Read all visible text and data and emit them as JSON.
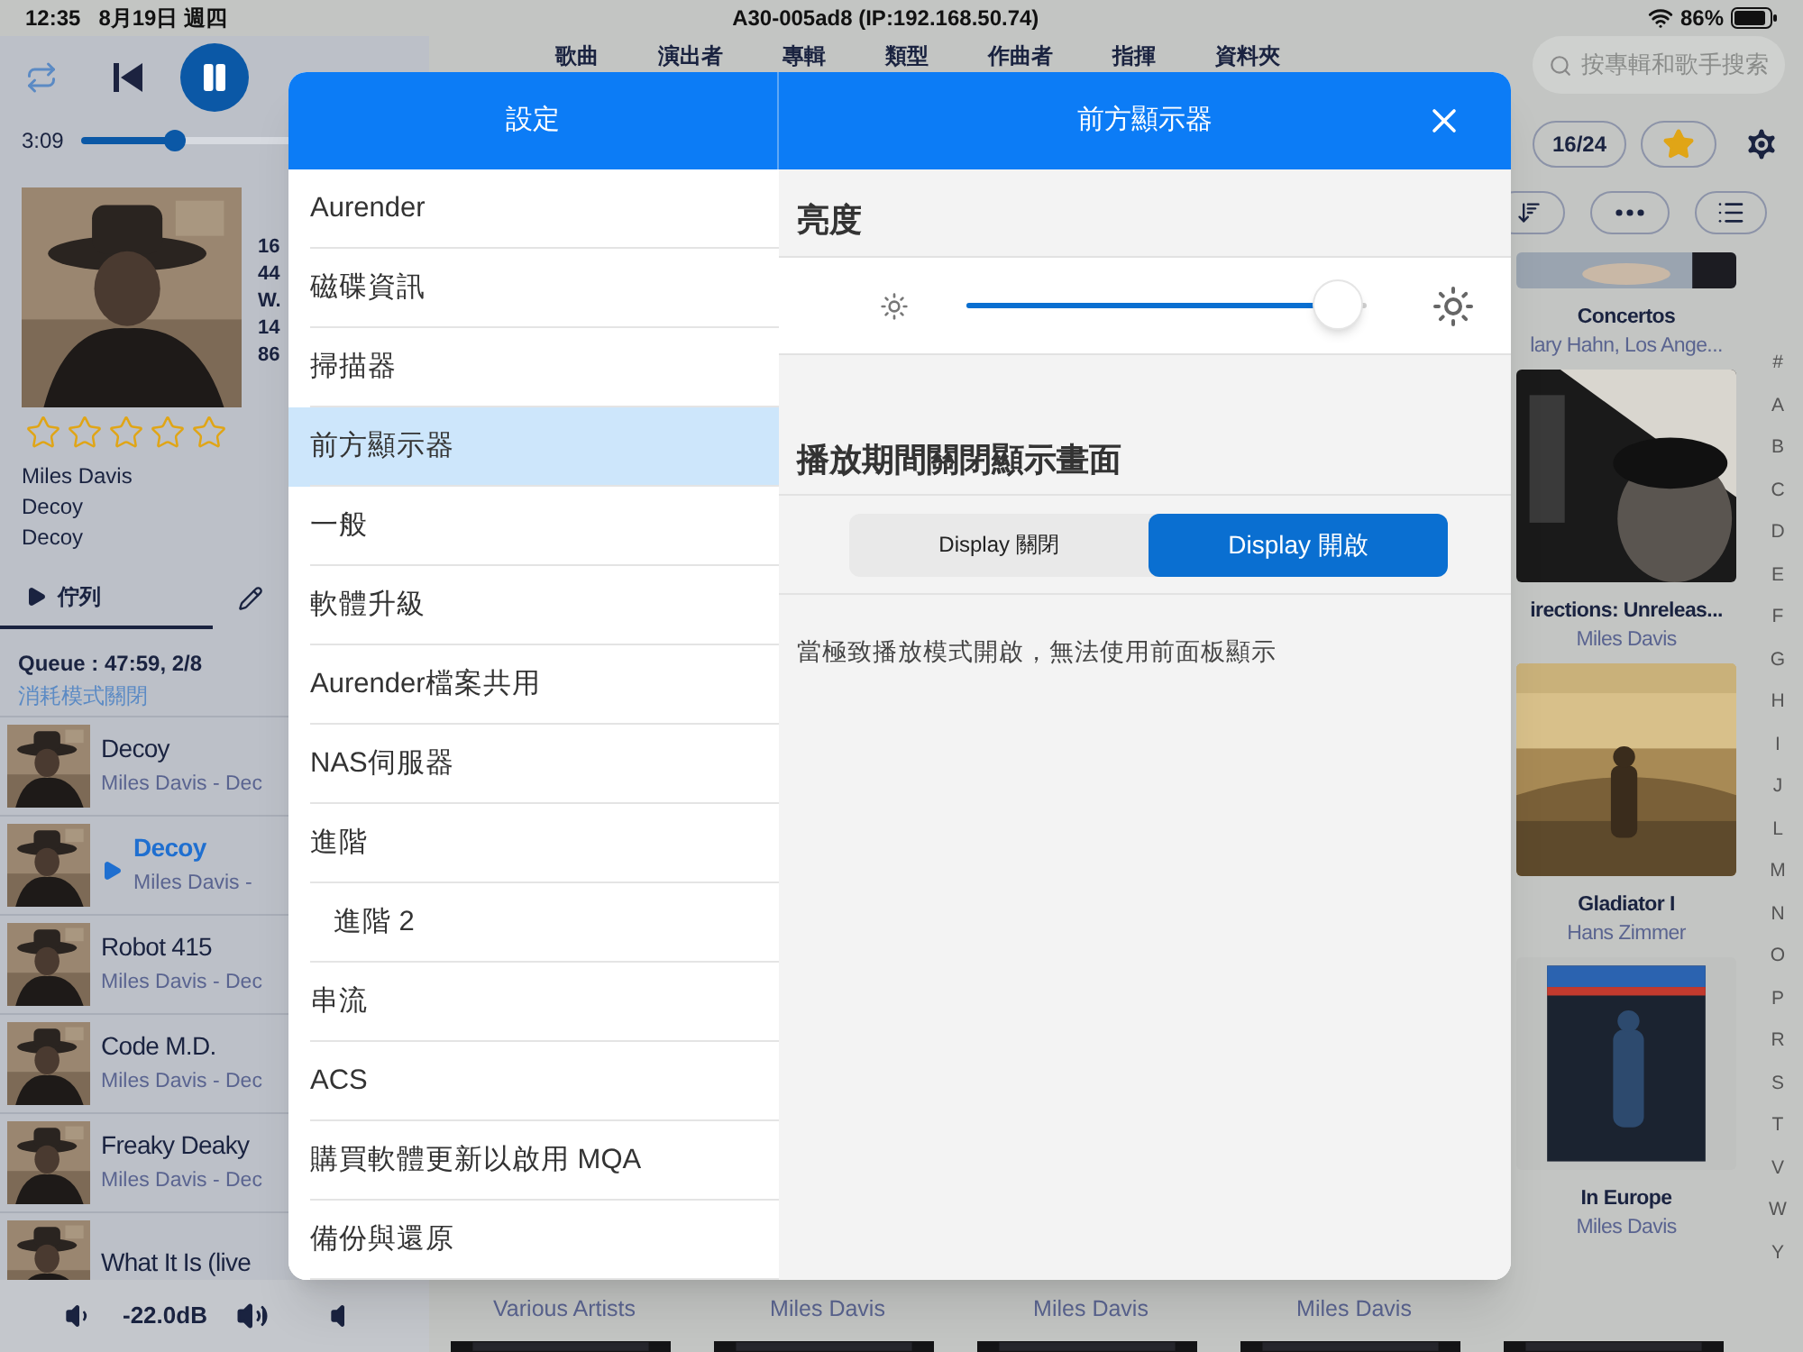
{
  "status_bar": {
    "time": "12:35",
    "date": "8月19日 週四",
    "device": "A30-005ad8 (IP:192.168.50.74)",
    "battery": "86%"
  },
  "player": {
    "elapsed": "3:09",
    "level": 0.28
  },
  "now_playing": {
    "stars": 0,
    "info": [
      "16",
      "44",
      "W.",
      "14",
      "86"
    ],
    "lines": [
      "Miles Davis",
      "Decoy",
      "Decoy"
    ]
  },
  "panel_tabs": [
    {
      "label": "佇列",
      "kind": "queue",
      "selected": true
    },
    {
      "kind": "edit",
      "selected": false
    }
  ],
  "queue": {
    "summary": "Queue : 47:59, 2/8",
    "mode": "消耗模式關閉",
    "tracks": [
      {
        "title": "Decoy",
        "subtitle": "Miles Davis - Dec",
        "playing": false
      },
      {
        "title": "Decoy",
        "subtitle": "Miles Davis -",
        "playing": true
      },
      {
        "title": "Robot 415",
        "subtitle": "Miles Davis - Dec",
        "playing": false
      },
      {
        "title": "Code M.D.",
        "subtitle": "Miles Davis - Dec",
        "playing": false
      },
      {
        "title": "Freaky Deaky",
        "subtitle": "Miles Davis - Dec",
        "playing": false
      },
      {
        "title": "What It Is (live",
        "playing": false
      }
    ]
  },
  "volume": {
    "reading": "-22.0dB"
  },
  "nav_tabs": [
    "歌曲",
    "演出者",
    "專輯",
    "類型",
    "作曲者",
    "指揮",
    "資料夾"
  ],
  "search": {
    "placeholder": "按專輯和歌手搜索"
  },
  "toolbar": {
    "count": "16/24",
    "favorite": true
  },
  "albums": [
    {
      "title": "Concertos",
      "artist": "lary Hahn, Los Ange..."
    },
    {
      "title": "irections: Unreleas...",
      "artist": "Miles Davis"
    },
    {
      "title": "Gladiator I",
      "artist": "Hans Zimmer"
    },
    {
      "title": "In Europe",
      "artist": "Miles Davis"
    }
  ],
  "bottom_artists": [
    "Various Artists",
    "Miles Davis",
    "Miles Davis",
    "Miles Davis"
  ],
  "alphabet": [
    "#",
    "A",
    "B",
    "C",
    "D",
    "E",
    "F",
    "G",
    "H",
    "I",
    "J",
    "L",
    "M",
    "N",
    "O",
    "P",
    "R",
    "S",
    "T",
    "V",
    "W",
    "Y"
  ],
  "settings": {
    "title": "設定",
    "items": [
      {
        "label": "Aurender",
        "selected": false
      },
      {
        "label": "磁碟資訊",
        "selected": false
      },
      {
        "label": "掃描器",
        "selected": false
      },
      {
        "label": "前方顯示器",
        "selected": true
      },
      {
        "label": "一般",
        "selected": false
      },
      {
        "label": "軟體升級",
        "selected": false
      },
      {
        "label": "Aurender檔案共用",
        "selected": false
      },
      {
        "label": "NAS伺服器",
        "selected": false
      },
      {
        "label": "進階",
        "selected": false,
        "children": [
          {
            "label": "進階 2",
            "selected": false
          }
        ]
      },
      {
        "label": "串流",
        "selected": false
      },
      {
        "label": "ACS",
        "selected": false
      },
      {
        "label": "購買軟體更新以啟用 MQA",
        "selected": false
      },
      {
        "label": "備份與還原",
        "selected": false
      }
    ]
  },
  "detail": {
    "title": "前方顯示器",
    "brightness": {
      "label": "亮度",
      "level": 0.93
    },
    "display_off": {
      "label": "播放期間關閉顯示畫面",
      "options": [
        {
          "label": "Display 關閉",
          "selected": false
        },
        {
          "label": "Display 開啟",
          "selected": true
        }
      ]
    },
    "note": "當極致播放模式開啟，無法使用前面板顯示"
  }
}
